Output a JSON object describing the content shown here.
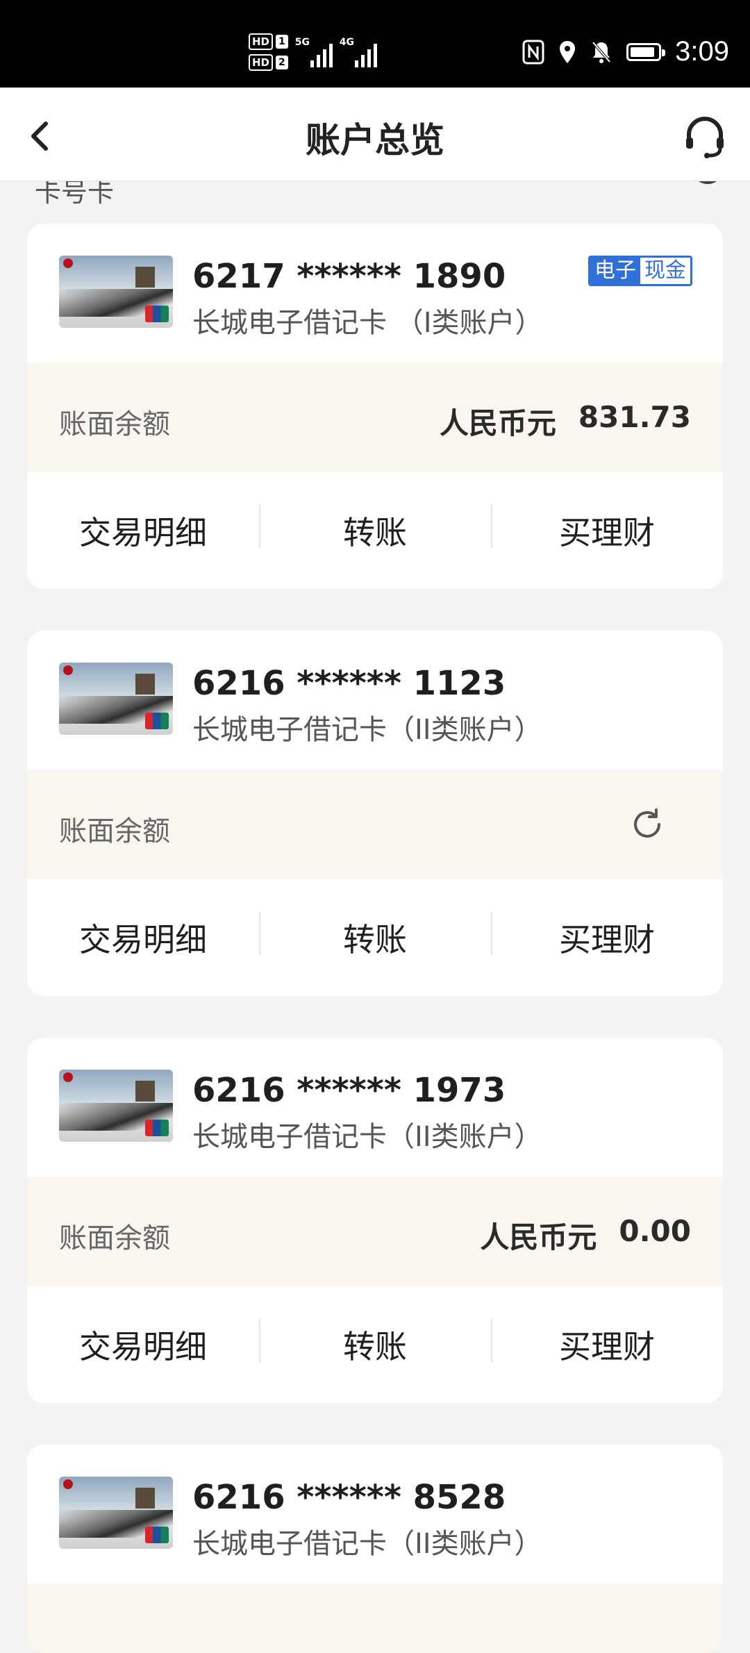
{
  "status_bar": {
    "hd1": "HD",
    "hd1_num": "1",
    "hd2": "HD",
    "hd2_num": "2",
    "net1": "5G",
    "net2": "4G",
    "time": "3:09"
  },
  "header": {
    "title": "账户总览",
    "back_icon": "chevron-left-icon",
    "support_icon": "headset-icon"
  },
  "peek_text": "卡号卡",
  "colors": {
    "accent_blue": "#2e6fd8",
    "balance_bg": "#f9f6ef",
    "page_bg": "#f3f3f3"
  },
  "cards": [
    {
      "number": "6217 ****** 1890",
      "type": "长城电子借记卡 （I类账户）",
      "badge_left": "电子",
      "badge_right": "现金",
      "balance_label": "账面余额",
      "currency": "人民币元",
      "balance": "831.73",
      "actions": [
        "交易明细",
        "转账",
        "买理财"
      ]
    },
    {
      "number": "6216 ****** 1123",
      "type": "长城电子借记卡（II类账户）",
      "balance_label": "账面余额",
      "actions": [
        "交易明细",
        "转账",
        "买理财"
      ]
    },
    {
      "number": "6216 ****** 1973",
      "type": "长城电子借记卡（II类账户）",
      "balance_label": "账面余额",
      "currency": "人民币元",
      "balance": "0.00",
      "actions": [
        "交易明细",
        "转账",
        "买理财"
      ]
    },
    {
      "number": "6216 ****** 8528",
      "type": "长城电子借记卡（II类账户）"
    }
  ]
}
